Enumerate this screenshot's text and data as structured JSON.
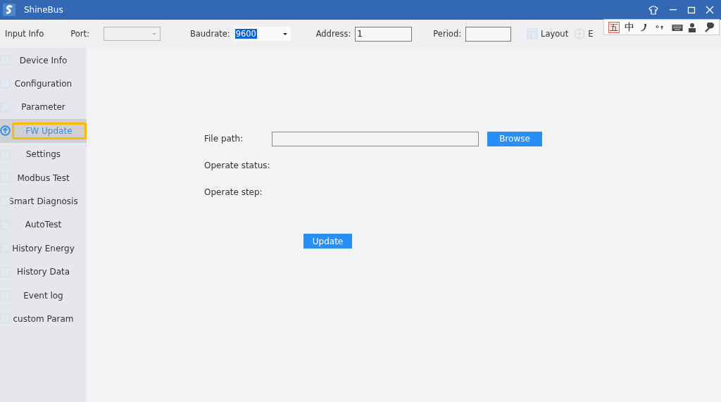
{
  "window": {
    "title": "ShineBus"
  },
  "toolbar": {
    "title": "Input Info",
    "port": {
      "label": "Port:"
    },
    "baudrate": {
      "label": "Baudrate:",
      "value": "9600"
    },
    "address": {
      "label": "Address:",
      "value": "1"
    },
    "period": {
      "label": "Period:"
    },
    "menu": [
      {
        "label": "Layout"
      },
      {
        "label": "E"
      }
    ]
  },
  "sidebar": {
    "items": [
      {
        "label": "Device Info",
        "selected": false,
        "highlighted": false
      },
      {
        "label": "Configuration",
        "selected": false,
        "highlighted": false
      },
      {
        "label": "Parameter",
        "selected": false,
        "highlighted": false
      },
      {
        "label": "FW Update",
        "selected": true,
        "highlighted": true
      },
      {
        "label": "Settings",
        "selected": false,
        "highlighted": false
      },
      {
        "label": "Modbus Test",
        "selected": false,
        "highlighted": false
      },
      {
        "label": "Smart Diagnosis",
        "selected": false,
        "highlighted": false
      },
      {
        "label": "AutoTest",
        "selected": false,
        "highlighted": false
      },
      {
        "label": "History Energy",
        "selected": false,
        "highlighted": false
      },
      {
        "label": "History Data",
        "selected": false,
        "highlighted": false
      },
      {
        "label": "Event log",
        "selected": false,
        "highlighted": false
      },
      {
        "label": "custom Param",
        "selected": false,
        "highlighted": false
      }
    ]
  },
  "fw_update": {
    "file_path_label": "File path:",
    "browse_button": "Browse",
    "status_label": "Operate status:",
    "step_label": "Operate step:",
    "update_button": "Update"
  },
  "ime_bar": {
    "labels": [
      "五",
      "中"
    ]
  }
}
